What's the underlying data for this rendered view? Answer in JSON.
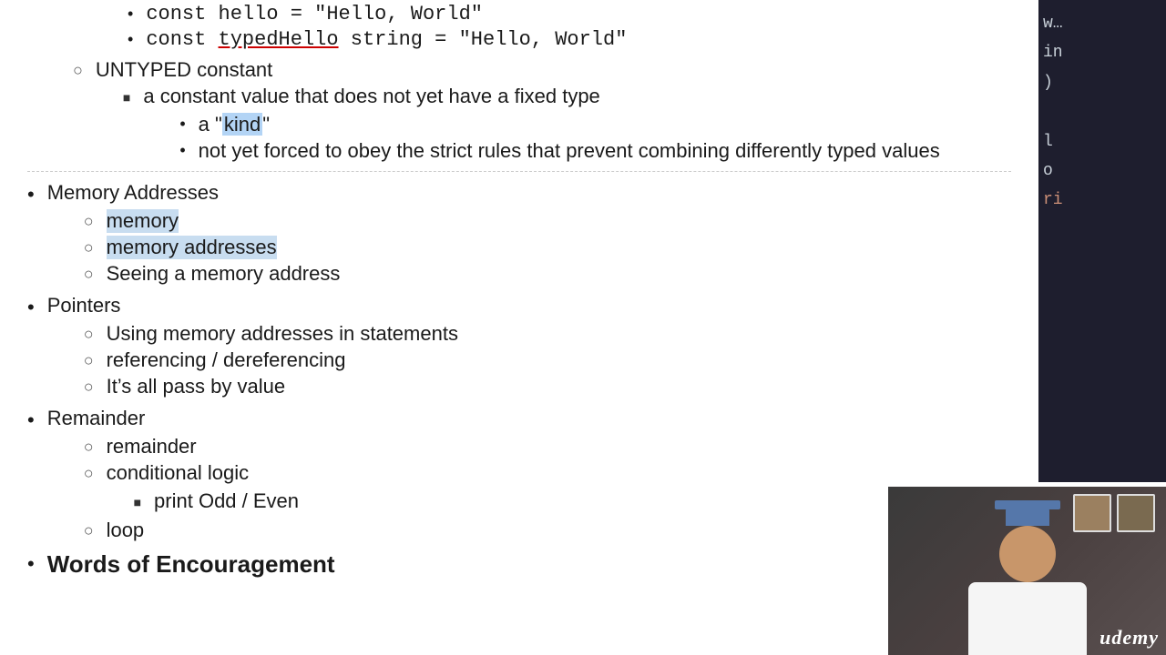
{
  "content": {
    "top_items": [
      {
        "type": "level4",
        "text": "const hello = \"Hello, World\""
      },
      {
        "type": "level4",
        "text": "const ",
        "rest": "typedHello",
        "rest2": " string = \"Hello, World\"",
        "underline": true
      }
    ],
    "untyped": {
      "label": "UNTYPED constant",
      "children": [
        {
          "type": "square",
          "text": "a constant value that does not yet have a fixed type",
          "children": [
            {
              "text": "a “kind”",
              "highlight": "kind"
            },
            {
              "text": "not yet forced to obey the strict rules that prevent combining differently typed values"
            }
          ]
        }
      ]
    },
    "sections": [
      {
        "id": "memory-addresses",
        "label": "Memory Addresses",
        "highlighted": true,
        "children": [
          {
            "text": "memory",
            "highlighted": true
          },
          {
            "text": "memory addresses",
            "highlighted": true
          },
          {
            "text": "Seeing a memory address"
          }
        ]
      },
      {
        "id": "pointers",
        "label": "Pointers",
        "children": [
          {
            "text": "Using memory addresses in statements"
          },
          {
            "text": "referencing / dereferencing"
          },
          {
            "text": "It’s all pass by value"
          }
        ]
      },
      {
        "id": "remainder",
        "label": "Remainder",
        "children": [
          {
            "text": "remainder"
          },
          {
            "text": "conditional logic",
            "children": [
              {
                "text": "print Odd / Even"
              }
            ]
          },
          {
            "text": "loop"
          }
        ]
      },
      {
        "id": "words",
        "label": "Words of Encouragement"
      }
    ],
    "right_panel": {
      "lines": [
        "w…",
        "in",
        ")",
        "l",
        "o",
        "ri"
      ]
    },
    "udemy_logo": "udemy"
  }
}
